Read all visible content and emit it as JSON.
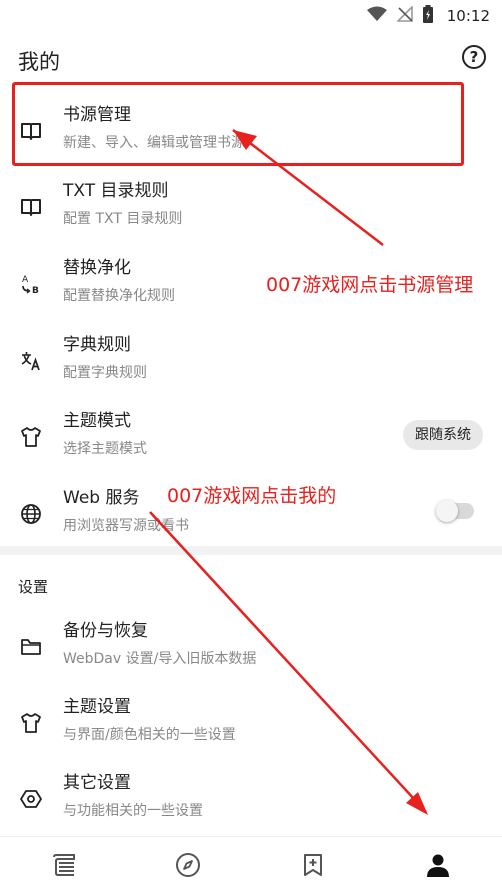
{
  "status_bar": {
    "time": "10:12",
    "icons": [
      "wifi-icon",
      "no-signal-icon",
      "battery-charging-icon"
    ]
  },
  "header": {
    "title": "我的",
    "help_icon": "help-circle-icon",
    "help_label": "?"
  },
  "menu": {
    "items": [
      {
        "icon": "book-icon",
        "title": "书源管理",
        "subtitle": "新建、导入、编辑或管理书源"
      },
      {
        "icon": "book-icon",
        "title": "TXT 目录规则",
        "subtitle": "配置 TXT 目录规则"
      },
      {
        "icon": "replace-icon",
        "title": "替换净化",
        "subtitle": "配置替换净化规则"
      },
      {
        "icon": "translate-icon",
        "title": "字典规则",
        "subtitle": "配置字典规则"
      },
      {
        "icon": "shirt-icon",
        "title": "主题模式",
        "subtitle": "选择主题模式",
        "chip": "跟随系统"
      },
      {
        "icon": "globe-icon",
        "title": "Web 服务",
        "subtitle": "用浏览器写源或看书",
        "toggle_on": false
      }
    ]
  },
  "settings": {
    "header": "设置",
    "items": [
      {
        "icon": "folder-icon",
        "title": "备份与恢复",
        "subtitle": "WebDav 设置/导入旧版本数据"
      },
      {
        "icon": "shirt-icon",
        "title": "主题设置",
        "subtitle": "与界面/颜色相关的一些设置"
      },
      {
        "icon": "hexagon-settings-icon",
        "title": "其它设置",
        "subtitle": "与功能相关的一些设置"
      }
    ]
  },
  "annotations": {
    "book_source": "007游戏网点击书源管理",
    "mine": "007游戏网点击我的",
    "color": "#e8201e"
  },
  "bottom_nav": {
    "items": [
      "bookshelf-icon",
      "explore-compass-icon",
      "rss-bookmark-icon",
      "person-icon"
    ],
    "active_index": 3
  }
}
